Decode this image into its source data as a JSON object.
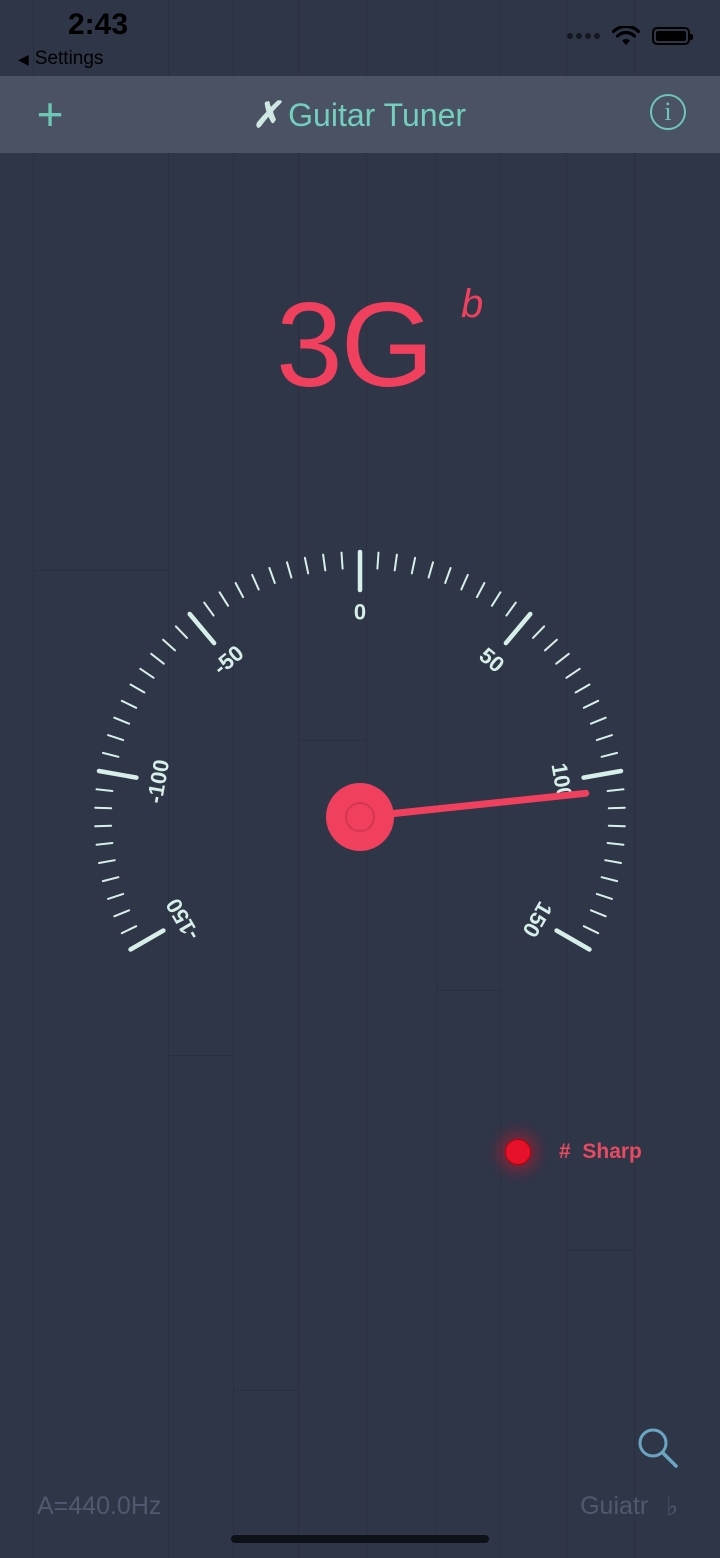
{
  "status_bar": {
    "time": "2:43",
    "back_label": "Settings"
  },
  "nav": {
    "title": "Guitar Tuner",
    "add_symbol": "+",
    "info_symbol": "i"
  },
  "note": {
    "octave_note": "3G",
    "accidental": "b"
  },
  "gauge": {
    "labels": [
      {
        "value": -150,
        "text": "-150"
      },
      {
        "value": -100,
        "text": "-100"
      },
      {
        "value": -50,
        "text": "-50"
      },
      {
        "value": 0,
        "text": "0"
      },
      {
        "value": 50,
        "text": "50"
      },
      {
        "value": 100,
        "text": "100"
      },
      {
        "value": 150,
        "text": "150"
      }
    ],
    "reading_cents": 105,
    "needle_color": "#f0405e",
    "tick_color": "#d6efe8"
  },
  "indicator": {
    "symbol": "#",
    "label": "Sharp",
    "color": "#e8112b"
  },
  "footer": {
    "reference": "A=440.0Hz",
    "instrument": "Guiatr",
    "flat_symbol": "♭"
  }
}
